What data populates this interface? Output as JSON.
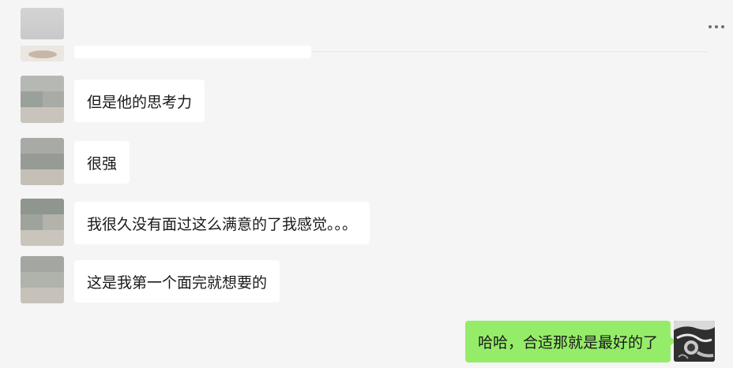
{
  "header": {
    "more_icon": "more-dots-icon"
  },
  "messages": [
    {
      "sender": "other",
      "text": "但是他的思考力"
    },
    {
      "sender": "other",
      "text": "很强"
    },
    {
      "sender": "other",
      "text": "我很久没有面过这么满意的了我感觉。。。"
    },
    {
      "sender": "other",
      "text": "这是我第一个面完就想要的"
    },
    {
      "sender": "self",
      "text": "哈哈，合适那就是最好的了"
    }
  ],
  "colors": {
    "background": "#f5f5f5",
    "incoming_bubble": "#ffffff",
    "outgoing_bubble": "#95ec69",
    "text": "#1a1a1a"
  }
}
